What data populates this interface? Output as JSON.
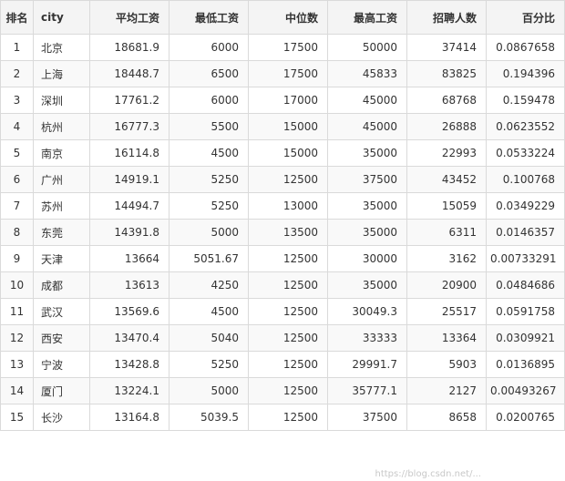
{
  "table": {
    "headers": [
      "排名",
      "city",
      "平均工资",
      "最低工资",
      "中位数",
      "最高工资",
      "招聘人数",
      "百分比"
    ],
    "rows": [
      [
        "1",
        "北京",
        "18681.9",
        "6000",
        "17500",
        "50000",
        "37414",
        "0.0867658"
      ],
      [
        "2",
        "上海",
        "18448.7",
        "6500",
        "17500",
        "45833",
        "83825",
        "0.194396"
      ],
      [
        "3",
        "深圳",
        "17761.2",
        "6000",
        "17000",
        "45000",
        "68768",
        "0.159478"
      ],
      [
        "4",
        "杭州",
        "16777.3",
        "5500",
        "15000",
        "45000",
        "26888",
        "0.0623552"
      ],
      [
        "5",
        "南京",
        "16114.8",
        "4500",
        "15000",
        "35000",
        "22993",
        "0.0533224"
      ],
      [
        "6",
        "广州",
        "14919.1",
        "5250",
        "12500",
        "37500",
        "43452",
        "0.100768"
      ],
      [
        "7",
        "苏州",
        "14494.7",
        "5250",
        "13000",
        "35000",
        "15059",
        "0.0349229"
      ],
      [
        "8",
        "东莞",
        "14391.8",
        "5000",
        "13500",
        "35000",
        "6311",
        "0.0146357"
      ],
      [
        "9",
        "天津",
        "13664",
        "5051.67",
        "12500",
        "30000",
        "3162",
        "0.00733291"
      ],
      [
        "10",
        "成都",
        "13613",
        "4250",
        "12500",
        "35000",
        "20900",
        "0.0484686"
      ],
      [
        "11",
        "武汉",
        "13569.6",
        "4500",
        "12500",
        "30049.3",
        "25517",
        "0.0591758"
      ],
      [
        "12",
        "西安",
        "13470.4",
        "5040",
        "12500",
        "33333",
        "13364",
        "0.0309921"
      ],
      [
        "13",
        "宁波",
        "13428.8",
        "5250",
        "12500",
        "29991.7",
        "5903",
        "0.0136895"
      ],
      [
        "14",
        "厦门",
        "13224.1",
        "5000",
        "12500",
        "35777.1",
        "2127",
        "0.00493267"
      ],
      [
        "15",
        "长沙",
        "13164.8",
        "5039.5",
        "12500",
        "37500",
        "8658",
        "0.0200765"
      ]
    ]
  },
  "watermark": "https://blog.csdn.net/..."
}
